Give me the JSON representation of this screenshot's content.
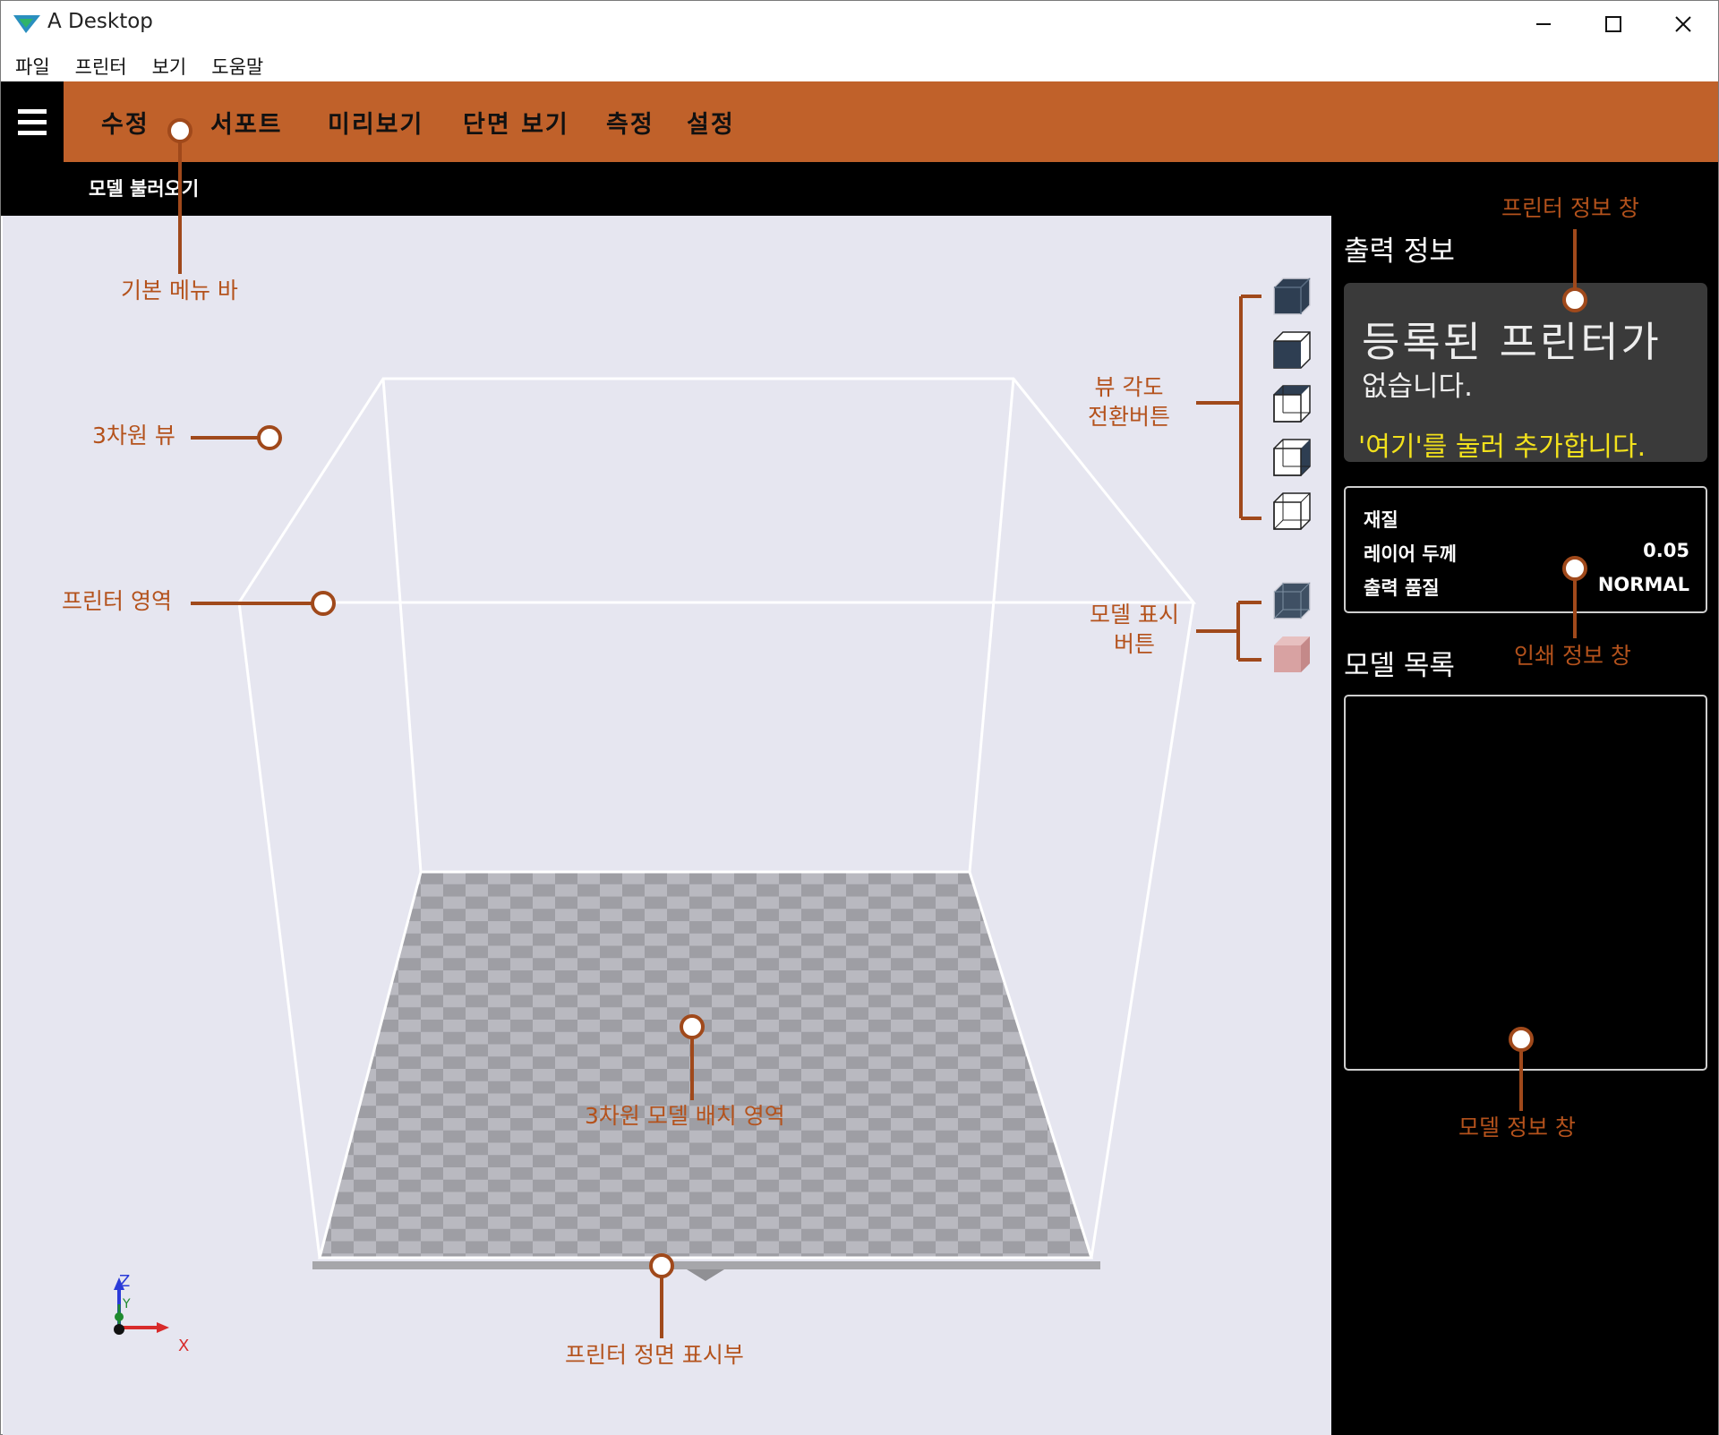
{
  "window": {
    "title": "A Desktop"
  },
  "menubar": {
    "items": [
      "파일",
      "프린터",
      "보기",
      "도움말"
    ]
  },
  "tabs": {
    "items": [
      "수정",
      "서포트",
      "미리보기",
      "단면 보기",
      "측정",
      "설정"
    ]
  },
  "subbar": {
    "load_label": "모델 불러오기"
  },
  "panel": {
    "output_heading": "출력 정보",
    "printer_msg_line1": "등록된 프린터가",
    "printer_msg_line2": "없습니다.",
    "printer_add_link": "'여기'를 눌러 추가합니다.",
    "print_info": {
      "material_label": "재질",
      "layer_label": "레이어 두께",
      "layer_value": "0.05",
      "quality_label": "출력 품질",
      "quality_value": "NORMAL"
    },
    "model_list_heading": "모델 목록"
  },
  "axes": {
    "z": "Z",
    "y": "Y",
    "x": "X"
  },
  "annotations": {
    "main_menu_bar": "기본 메뉴 바",
    "view_3d": "3차원 뷰",
    "printer_area": "프린터 영역",
    "view_angle_buttons_l1": "뷰 각도",
    "view_angle_buttons_l2": "전환버튼",
    "model_display_buttons_l1": "모델 표시",
    "model_display_buttons_l2": "버튼",
    "printer_info_window": "프린터 정보 창",
    "print_info_window": "인쇄 정보 창",
    "model_info_window": "모델 정보 창",
    "placement_area": "3차원 모델 배치 영역",
    "printer_front": "프린터 정면 표시부"
  },
  "colors": {
    "accent_orange": "#c0612a",
    "annotation": "#b4521c",
    "viewport_bg": "#e6e6f0",
    "panel_bg": "#000000",
    "link_yellow": "#f2e11c"
  }
}
